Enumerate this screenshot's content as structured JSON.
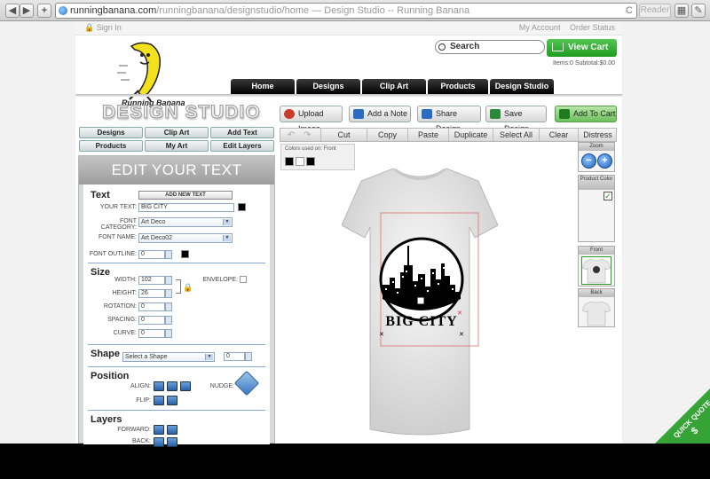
{
  "browser": {
    "url_host": "runningbanana.com",
    "url_path": "/runningbanana/designstudio/home",
    "url_title": " — Design Studio -- Running Banana",
    "reader": "Reader",
    "back": "◀",
    "forward": "▶",
    "add": "+",
    "reload": "C"
  },
  "top": {
    "sign_in": "Sign In",
    "my_account": "My Account",
    "order_status": "Order Status"
  },
  "logo": {
    "text": "Running Banana"
  },
  "search": {
    "label": "Search"
  },
  "cart": {
    "label": "View Cart",
    "info": "Items:0  Subtotal:$0.00"
  },
  "nav": [
    "Home",
    "Designs",
    "Clip Art",
    "Products",
    "Design Studio"
  ],
  "studio_title": "DESIGN STUDIO",
  "toolbar": {
    "upload": "Upload Image",
    "add_note": "Add a Note",
    "share": "Share Design",
    "save": "Save Design",
    "add_to_cart": "Add To Cart"
  },
  "left_tabs": [
    "Designs",
    "Clip Art",
    "Add Text",
    "Products",
    "My Art",
    "Edit Layers"
  ],
  "panel": {
    "title": "EDIT YOUR TEXT",
    "text_section": "Text",
    "add_new_text": "ADD NEW TEXT",
    "your_text_label": "YOUR TEXT:",
    "your_text_value": "BIG CITY",
    "font_category_label": "FONT CATEGORY:",
    "font_category_value": "Art Deco",
    "font_name_label": "FONT NAME:",
    "font_name_value": "Art Deco02",
    "font_outline_label": "FONT OUTLINE:",
    "font_outline_value": "0",
    "size_section": "Size",
    "width_label": "WIDTH:",
    "width_value": "102",
    "height_label": "HEIGHT:",
    "height_value": "26",
    "envelope_label": "ENVELOPE:",
    "rotation_label": "ROTATION:",
    "rotation_value": "0",
    "spacing_label": "SPACING:",
    "spacing_value": "0",
    "curve_label": "CURVE:",
    "curve_value": "0",
    "shape_section": "Shape",
    "shape_select": "Select a Shape",
    "shape_value": "0",
    "position_section": "Position",
    "align_label": "ALIGN:",
    "nudge_label": "NUDGE:",
    "flip_label": "FLIP:",
    "layers_section": "Layers",
    "forward_label": "FORWARD:",
    "back_label": "BACK:"
  },
  "edit_bar": [
    "Cut",
    "Copy",
    "Paste",
    "Duplicate",
    "Select All",
    "Clear",
    "Distress"
  ],
  "colors_used": {
    "label": "Colors used on: Front"
  },
  "design": {
    "text": "BIG CITY"
  },
  "right": {
    "zoom": "Zoom",
    "product_color": "Product Color",
    "front": "Front",
    "back": "Back"
  },
  "quick_quote": "QUICK QUOTE"
}
